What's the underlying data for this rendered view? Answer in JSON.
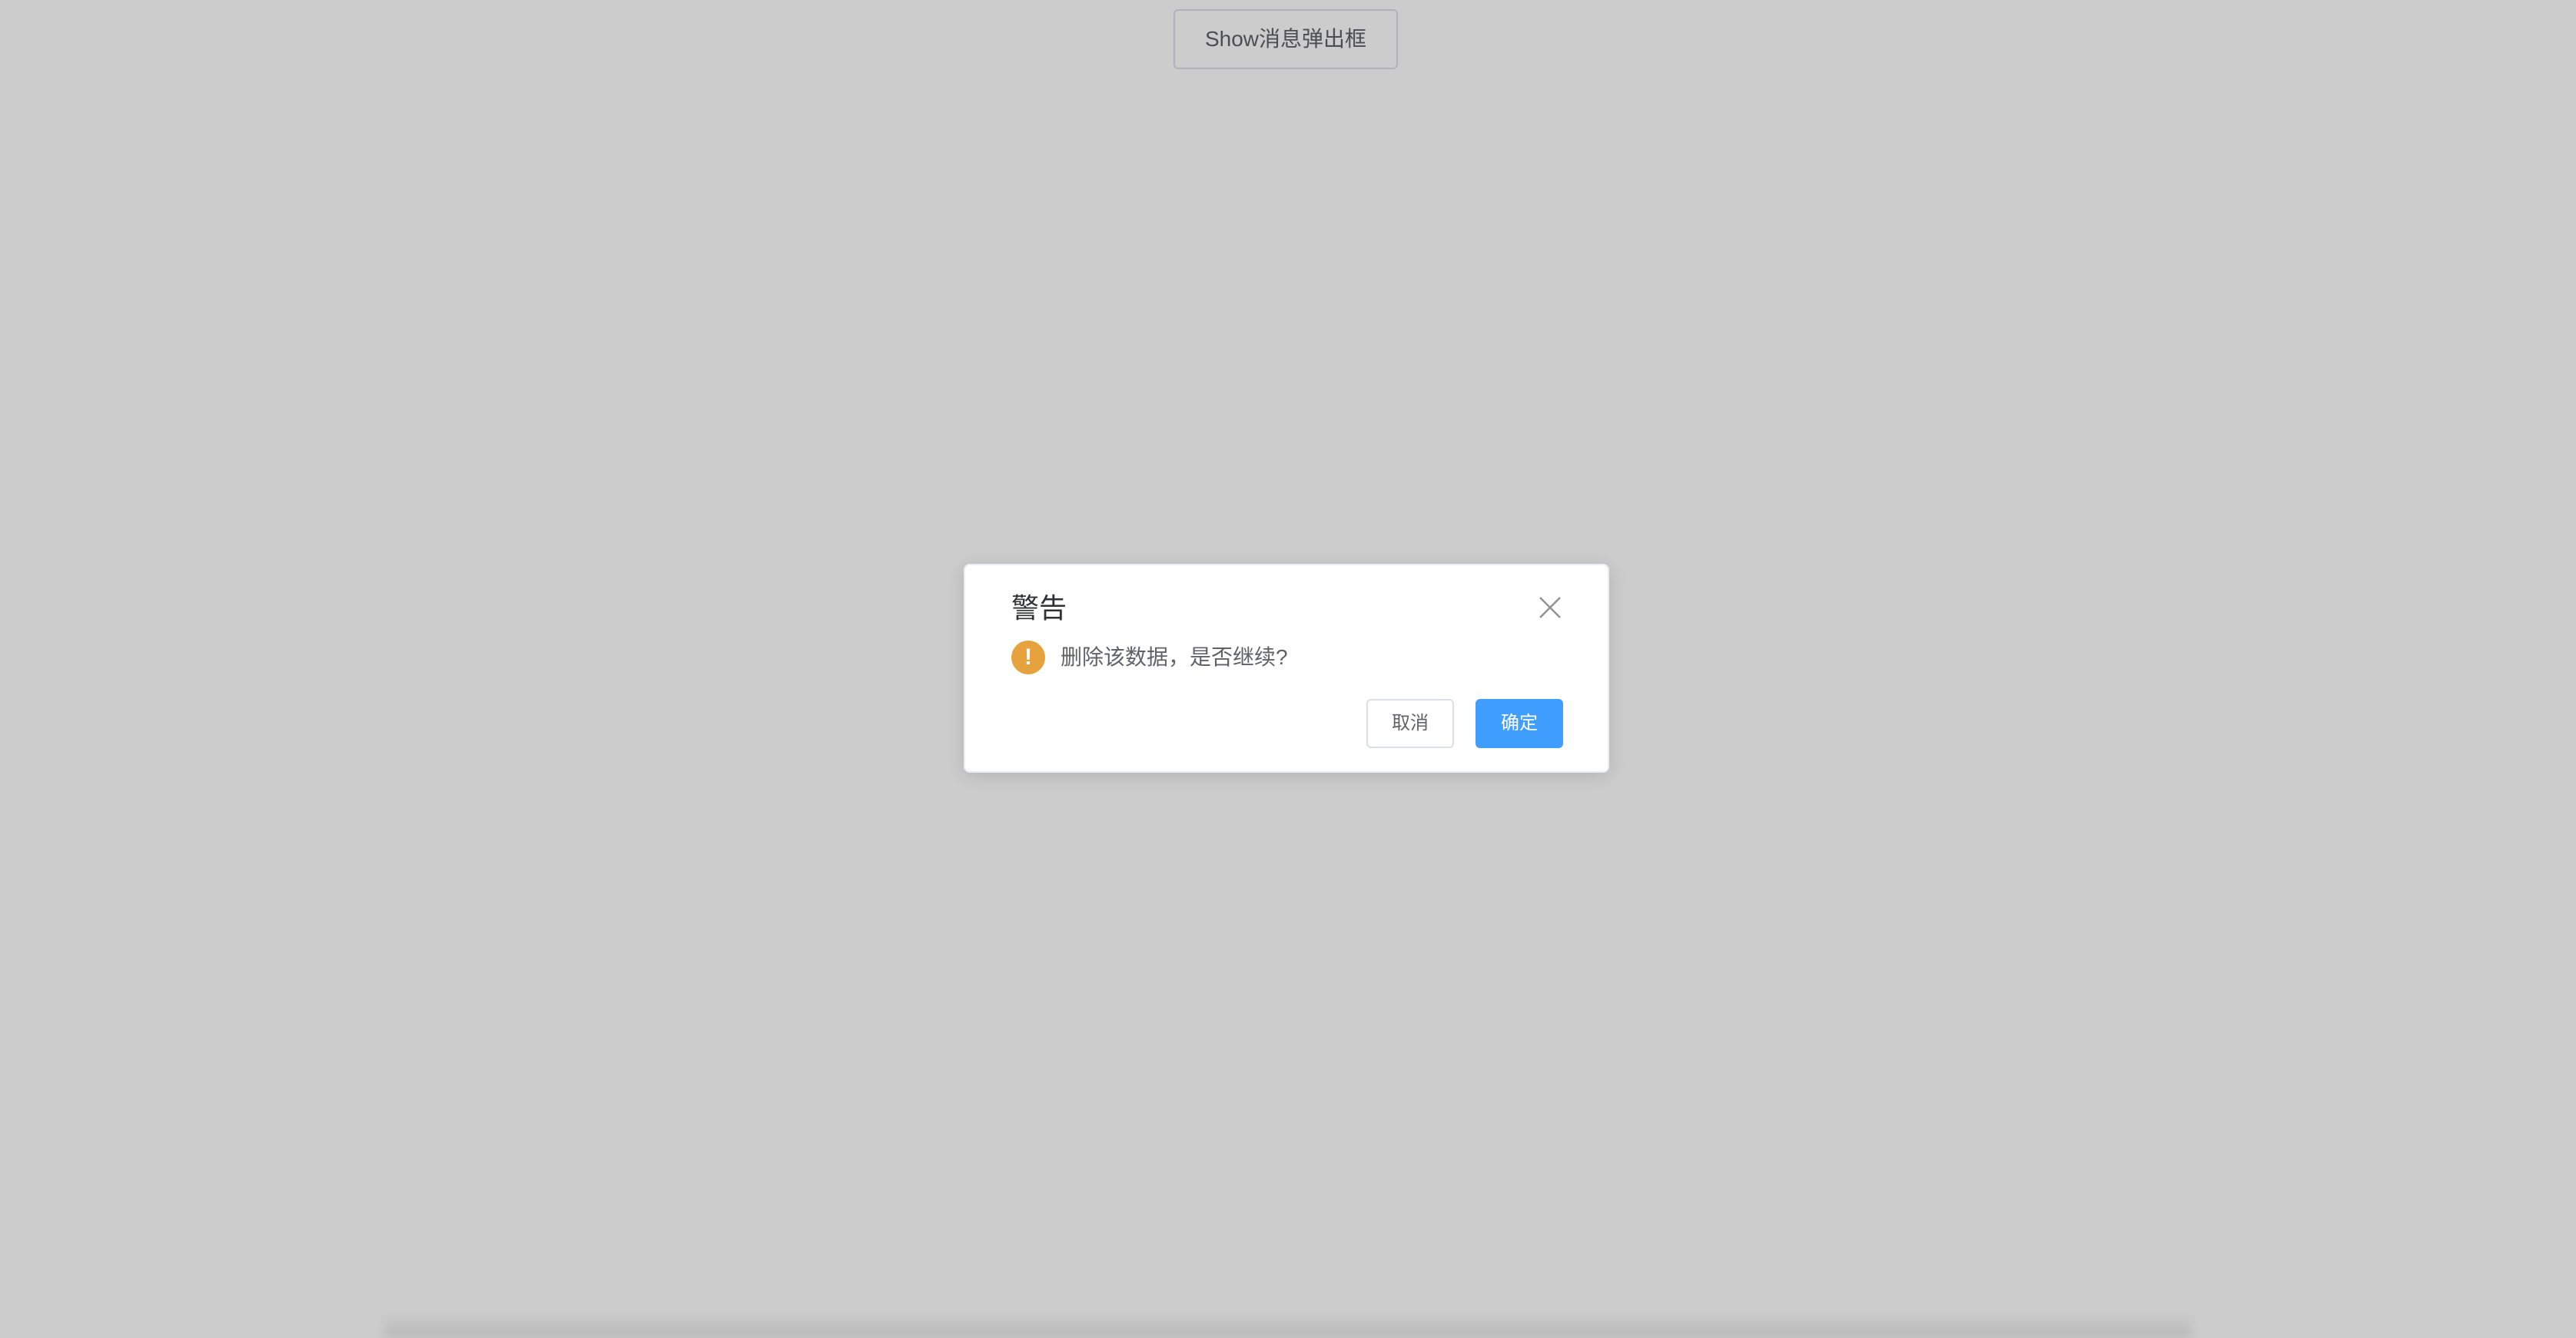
{
  "page": {
    "show_button_label": "Show消息弹出框"
  },
  "dialog": {
    "title": "警告",
    "message": "删除该数据，是否继续?",
    "warning_icon_glyph": "!",
    "cancel_label": "取消",
    "confirm_label": "确定",
    "close_icon": "close-icon",
    "warning_icon": "warning-icon"
  },
  "colors": {
    "primary": "#409eff",
    "warning": "#e6a23c",
    "overlay": "rgba(0,0,0,0.2)"
  }
}
